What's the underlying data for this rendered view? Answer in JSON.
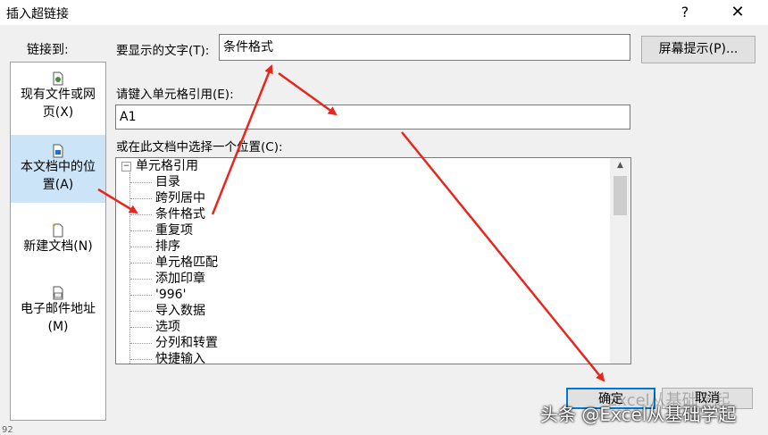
{
  "window": {
    "title": "插入超链接",
    "help_glyph": "?",
    "close_glyph": "✕"
  },
  "sidebar": {
    "label": "链接到:",
    "items": [
      {
        "line1": "现有文件或网",
        "line2": "页(X)",
        "icon": "file-web-icon",
        "selected": false
      },
      {
        "line1": "本文档中的位",
        "line2": "置(A)",
        "icon": "document-place-icon",
        "selected": true
      },
      {
        "line1": "新建文档(N)",
        "line2": "",
        "icon": "new-document-icon",
        "selected": false
      },
      {
        "line1": "电子邮件地址",
        "line2": "(M)",
        "icon": "email-icon",
        "selected": false
      }
    ]
  },
  "display_text": {
    "label": "要显示的文字(T):",
    "value": "条件格式"
  },
  "screen_tip_button": "屏幕提示(P)...",
  "cell_ref": {
    "label": "请键入单元格引用(E):",
    "value": "A1"
  },
  "place": {
    "label": "或在此文档中选择一个位置(C):",
    "root": "单元格引用",
    "items": [
      "目录",
      "跨列居中",
      "条件格式",
      "重复项",
      "排序",
      "单元格匹配",
      "添加印章",
      "'996'",
      "导入数据",
      "选项",
      "分列和转置",
      "快捷输入"
    ]
  },
  "buttons": {
    "ok": "确定",
    "cancel": "取消"
  },
  "watermark": {
    "text": "头条 @Excel从基础学起",
    "ghost": "Excel从基础学起"
  },
  "row_number": "92",
  "colors": {
    "arrow": "#e8261e",
    "selected": "#cce4f7",
    "focus": "#0078d7"
  }
}
